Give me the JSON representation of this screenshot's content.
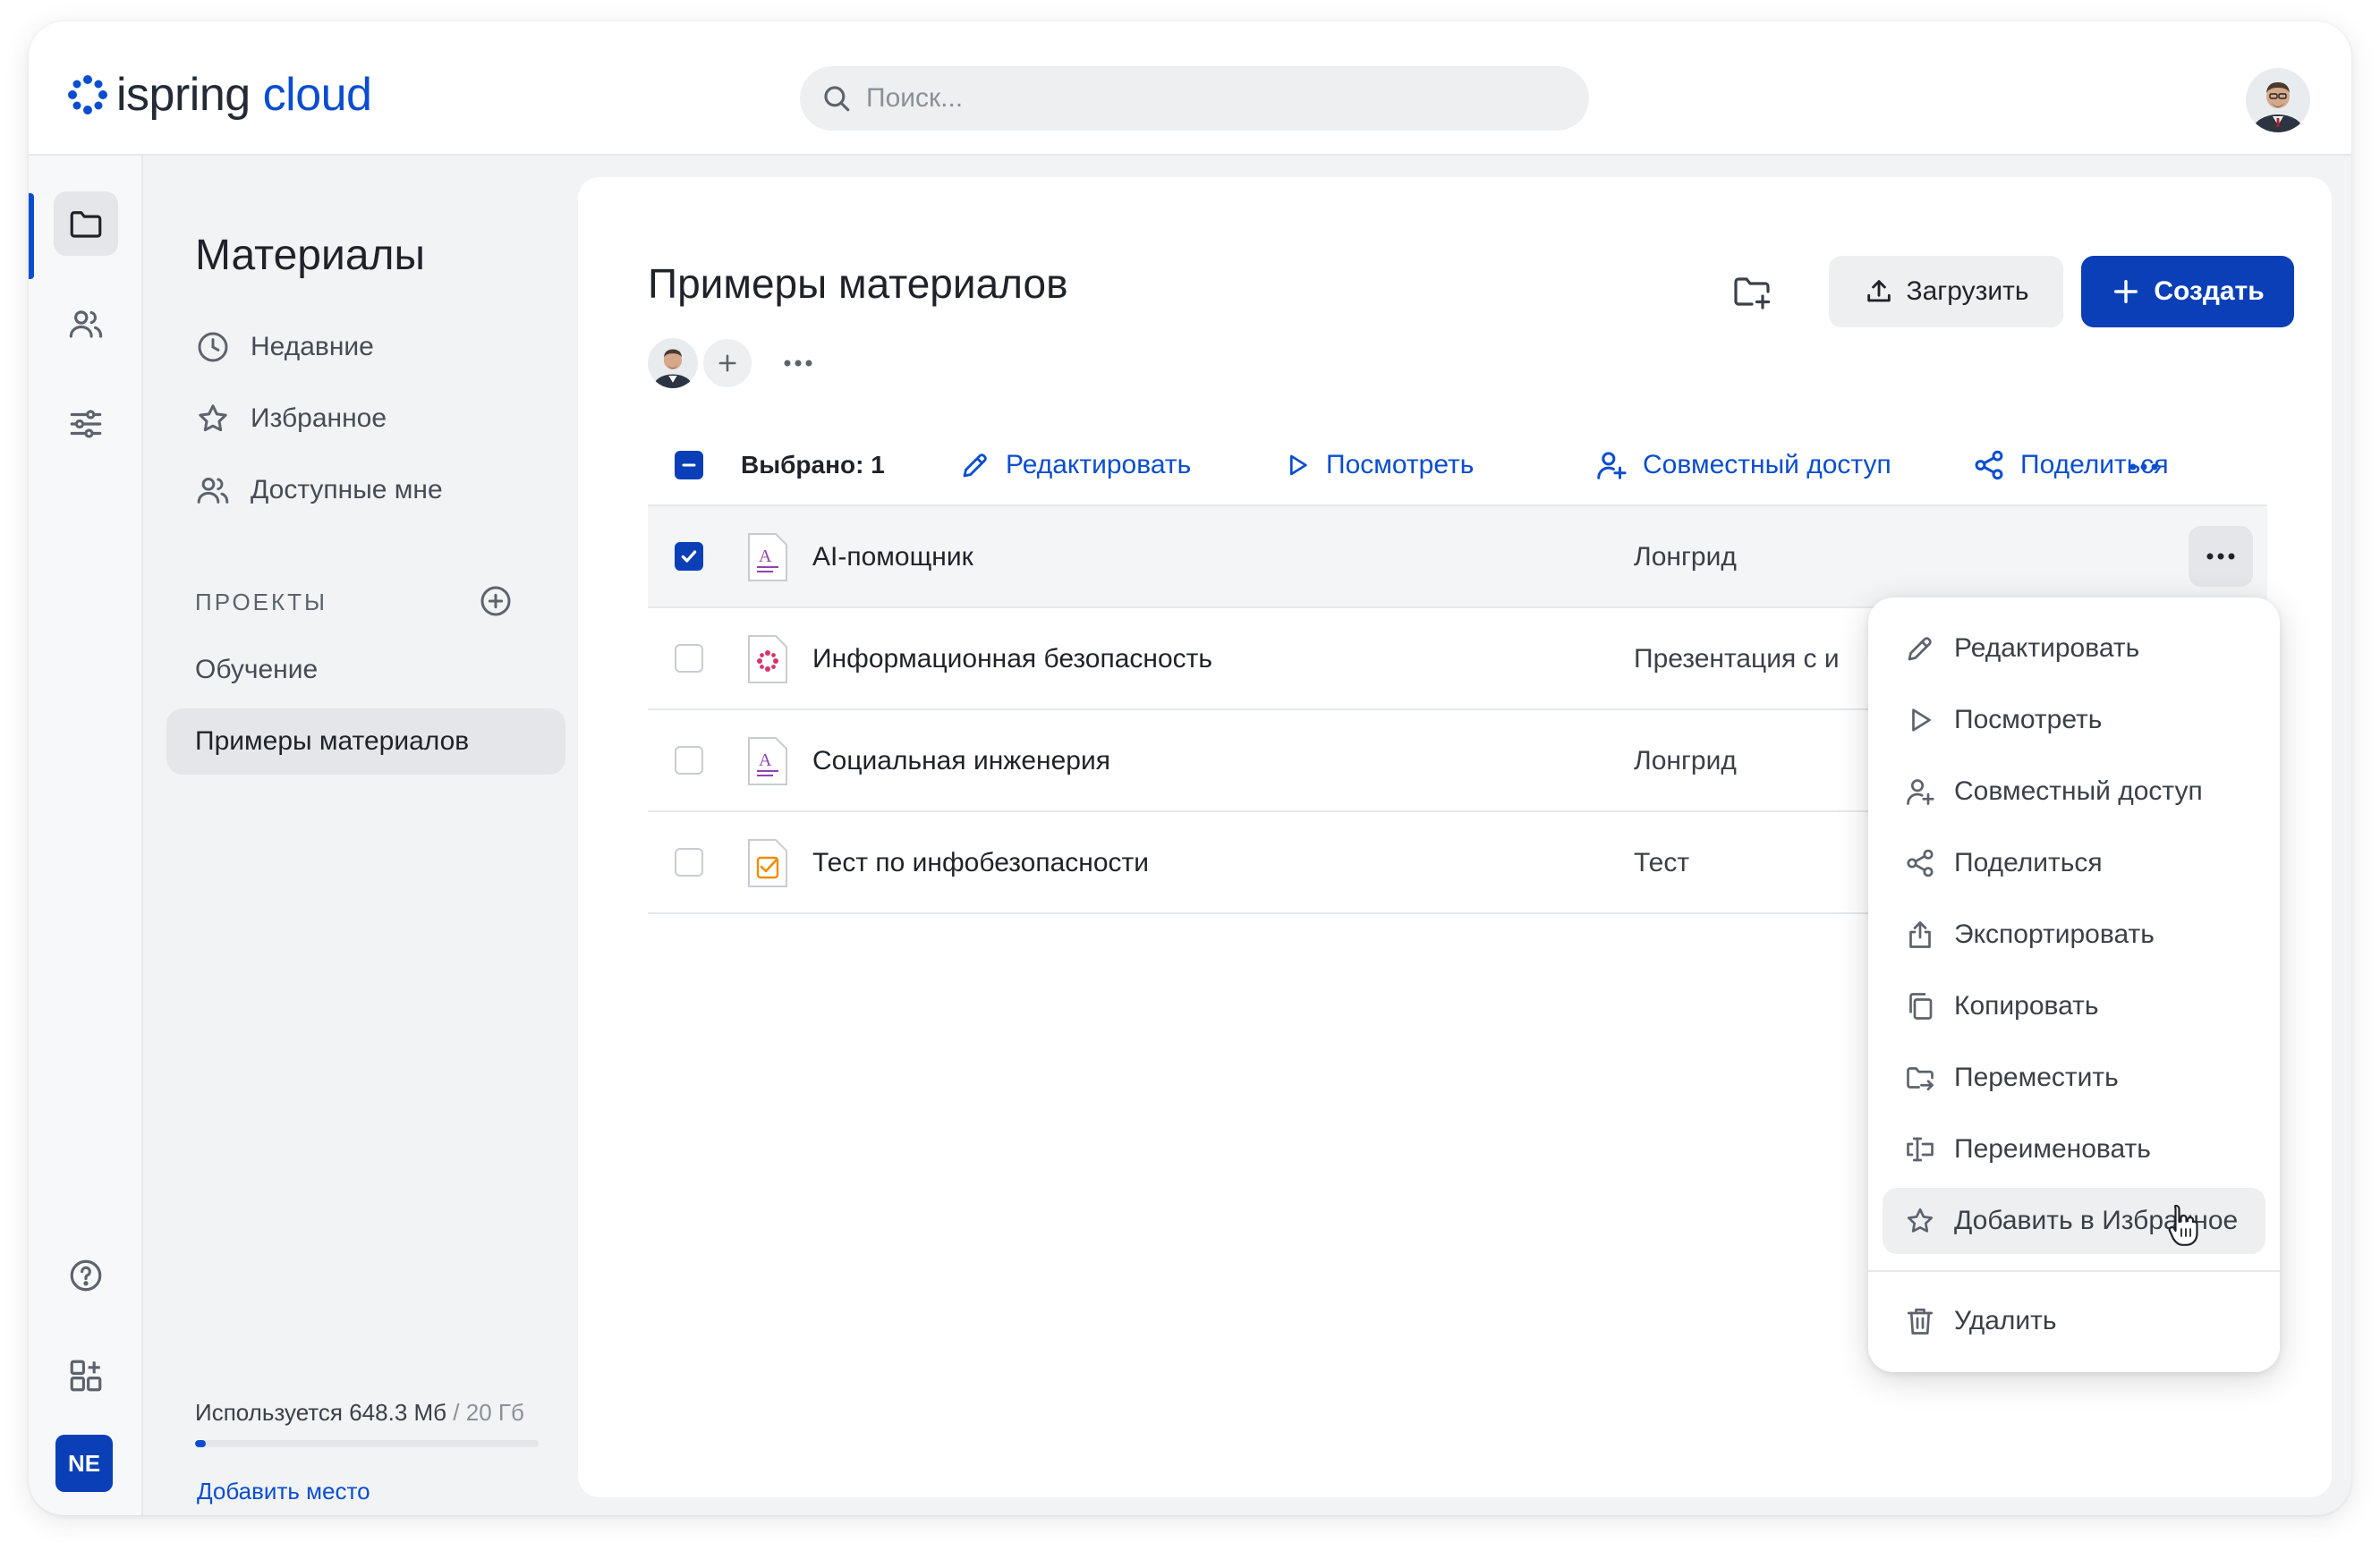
{
  "app": {
    "logo_word_1": "ispring",
    "logo_word_2": "cloud",
    "brand_color": "#0a4ecf",
    "primary_button_color": "#0a3fb8"
  },
  "header": {
    "search_placeholder": "Поиск..."
  },
  "rail": {
    "items": [
      "folder-icon",
      "users-icon",
      "sliders-icon",
      "help-icon",
      "apps-add-icon"
    ],
    "active": "folder-icon",
    "user_initials": "NE"
  },
  "nav": {
    "title": "Материалы",
    "items": [
      {
        "label": "Недавние",
        "icon": "clock-icon"
      },
      {
        "label": "Избранное",
        "icon": "star-icon"
      },
      {
        "label": "Доступные мне",
        "icon": "users-icon"
      }
    ],
    "projects_label": "ПРОЕКТЫ",
    "projects": [
      {
        "label": "Обучение",
        "active": false
      },
      {
        "label": "Примеры материалов",
        "active": true
      }
    ],
    "storage": {
      "used_text": "Используется 648.3 Мб",
      "total_text": " / 20 Гб",
      "used_fraction": 0.032
    },
    "add_space": "Добавить место"
  },
  "content": {
    "title": "Примеры материалов",
    "upload_label": "Загрузить",
    "create_label": "Создать",
    "toolbar": {
      "selected": "Выбрано: 1",
      "actions": [
        "Редактировать",
        "Посмотреть",
        "Совместный доступ",
        "Поделиться"
      ]
    },
    "rows": [
      {
        "name": "AI-помощник",
        "type": "Лонгрид",
        "checked": true,
        "icon": "longread-icon"
      },
      {
        "name": "Информационная безопасность",
        "type": "Презентация с и",
        "checked": false,
        "icon": "presentation-icon"
      },
      {
        "name": "Социальная инженерия",
        "type": "Лонгрид",
        "checked": false,
        "icon": "longread-icon"
      },
      {
        "name": "Тест по инфобезопасности",
        "type": "Тест",
        "checked": false,
        "icon": "quiz-icon"
      }
    ]
  },
  "context_menu": {
    "items": [
      {
        "label": "Редактировать",
        "icon": "pencil-icon"
      },
      {
        "label": "Посмотреть",
        "icon": "play-icon"
      },
      {
        "label": "Совместный доступ",
        "icon": "user-add-icon"
      },
      {
        "label": "Поделиться",
        "icon": "share-icon"
      },
      {
        "label": "Экспортировать",
        "icon": "export-icon"
      },
      {
        "label": "Копировать",
        "icon": "copy-icon"
      },
      {
        "label": "Переместить",
        "icon": "move-icon"
      },
      {
        "label": "Переименовать",
        "icon": "rename-icon"
      },
      {
        "label": "Добавить в Избранное",
        "icon": "star-icon",
        "hovered": true
      }
    ],
    "delete": {
      "label": "Удалить",
      "icon": "trash-icon"
    }
  }
}
